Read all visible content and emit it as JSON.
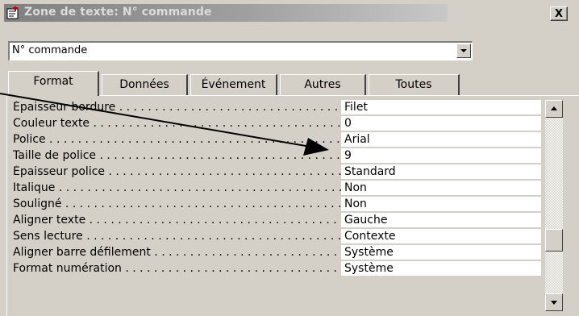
{
  "window": {
    "title": "Zone de texte: N° commande",
    "close_label": "X",
    "icon": "properties-icon"
  },
  "selector": {
    "value": "N° commande"
  },
  "tabs": [
    {
      "label": "Format",
      "active": true
    },
    {
      "label": "Données",
      "active": false
    },
    {
      "label": "Événement",
      "active": false
    },
    {
      "label": "Autres",
      "active": false
    },
    {
      "label": "Toutes",
      "active": false
    }
  ],
  "properties": [
    {
      "label": "Épaisseur bordure",
      "value": "Filet"
    },
    {
      "label": "Couleur texte",
      "value": "0"
    },
    {
      "label": "Police",
      "value": "Arial"
    },
    {
      "label": "Taille de police",
      "value": "9"
    },
    {
      "label": "Épaisseur police",
      "value": "Standard"
    },
    {
      "label": "Italique",
      "value": "Non"
    },
    {
      "label": "Souligné",
      "value": "Non"
    },
    {
      "label": "Aligner texte",
      "value": "Gauche"
    },
    {
      "label": "Sens lecture",
      "value": "Contexte"
    },
    {
      "label": "Aligner barre défilement",
      "value": "Système"
    },
    {
      "label": "Format numération",
      "value": "Système"
    }
  ],
  "scrollbar": {
    "position_fraction": 0.73
  },
  "annotation": {
    "icon": "pointer-arrow"
  }
}
